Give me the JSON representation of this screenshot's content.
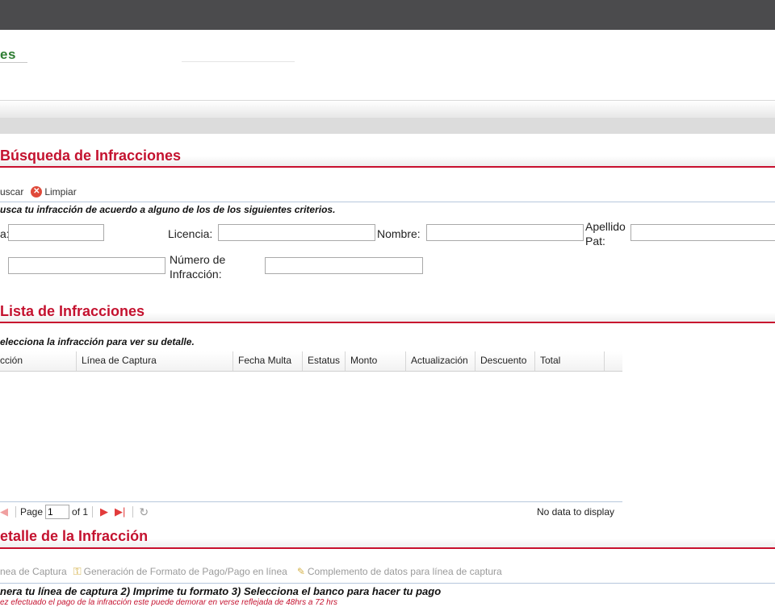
{
  "header": {
    "brand_text": "es"
  },
  "search": {
    "title": "Búsqueda de Infracciones",
    "toolbar": {
      "search_label": "uscar",
      "clear_label": "Limpiar"
    },
    "instruction": "usca tu infracción de acuerdo a alguno de los de los siguientes criterios.",
    "fields": {
      "first_label": "a:",
      "first_value": "",
      "license_label": "Licencia:",
      "license_value": "",
      "name_label": "Nombre:",
      "name_value": "",
      "lastname_label_line1": "Apellido",
      "lastname_label_line2": "Pat:",
      "lastname_value": "",
      "second_row_value": "",
      "infraction_number_label_line1": "Número de",
      "infraction_number_label_line2": "Infracción:",
      "infraction_number_value": ""
    }
  },
  "list": {
    "title": "Lista de Infracciones",
    "instruction": "elecciona la infracción para ver su detalle.",
    "columns": [
      "cción",
      "Línea de Captura",
      "Fecha Multa",
      "Estatus",
      "Monto",
      "Actualización",
      "Descuento",
      "Total"
    ],
    "rows": [],
    "pager": {
      "page_label": "Page",
      "page_value": "1",
      "of_label": "of 1",
      "empty_text": "No data to display"
    }
  },
  "detail": {
    "title": "etalle de la Infracción",
    "tabs": [
      "nea de Captura",
      "Generación de Formato de Pago/Pago en línea",
      "Complemento de datos para línea de captura"
    ],
    "steps_text": "nera tu línea de captura 2) Imprime tu formato 3) Selecciona el banco para hacer tu pago",
    "warning_text": "ez efectuado el pago de la infracción este puede demorar en verse reflejada de 48hrs a 72 hrs"
  },
  "colors": {
    "accent": "#c4122f",
    "topbar": "#4b4b4d",
    "brand": "#2e7d32"
  }
}
